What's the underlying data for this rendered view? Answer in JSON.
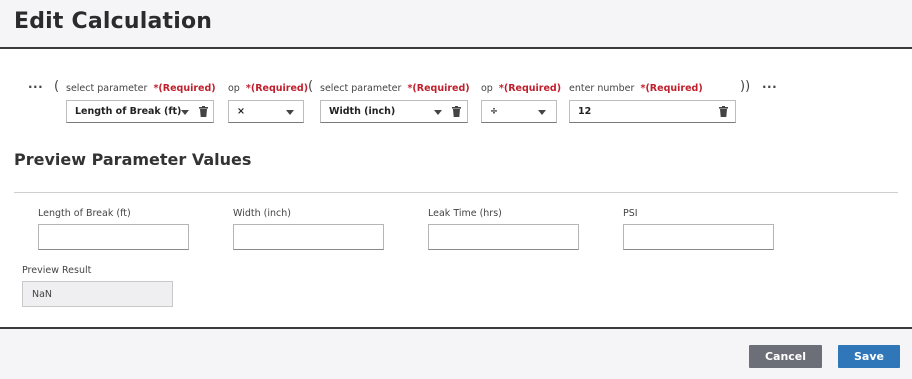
{
  "dialog": {
    "title": "Edit Calculation"
  },
  "expression": {
    "outer_open": "(",
    "outer_close": "))",
    "ellipsis_left": "···",
    "ellipsis_right": "···",
    "inner_open": "(",
    "required_text": "*(Required)",
    "param1": {
      "label": "select parameter",
      "value": "Length of Break (ft)"
    },
    "op1": {
      "label": "op",
      "value": "×"
    },
    "param2": {
      "label": "select parameter",
      "value": "Width (inch)"
    },
    "op2": {
      "label": "op",
      "value": "÷"
    },
    "number": {
      "label": "enter number",
      "value": "12"
    }
  },
  "preview": {
    "section_title": "Preview Parameter Values",
    "fields": [
      {
        "label": "Length of Break (ft)",
        "value": ""
      },
      {
        "label": "Width (inch)",
        "value": ""
      },
      {
        "label": "Leak Time (hrs)",
        "value": ""
      },
      {
        "label": "PSI",
        "value": ""
      }
    ],
    "result_label": "Preview Result",
    "result_value": "NaN"
  },
  "footer": {
    "cancel_label": "Cancel",
    "save_label": "Save"
  },
  "colors": {
    "required": "#c0202d",
    "save": "#2f77b9",
    "cancel": "#6c6f78"
  }
}
